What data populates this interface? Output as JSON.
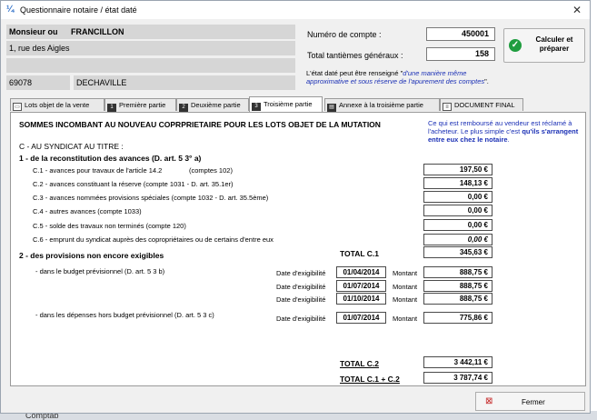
{
  "window": {
    "title": "Questionnaire notaire / état daté",
    "close_glyph": "✕"
  },
  "header": {
    "salutation": "Monsieur ou",
    "name": "FRANCILLON",
    "address1": "1, rue des Aigles",
    "address2": "",
    "postal_code": "69078",
    "city": "DECHAVILLE",
    "account_label": "Numéro de compte :",
    "account_value": "450001",
    "tantiemes_label": "Total tantièmes généraux :",
    "tantiemes_value": "158",
    "calc_button": "Calculer et préparer",
    "note_prefix": "L'état daté peut être renseigné \"",
    "note_italic": "d'une manière même approximative et sous réserve de l'apurement des comptes",
    "note_suffix": "\"."
  },
  "tabs": [
    {
      "label": "Lots objet de la vente",
      "active": false
    },
    {
      "label": "Première partie",
      "active": false
    },
    {
      "label": "Deuxième partie",
      "active": false
    },
    {
      "label": "Troisième partie",
      "active": true
    },
    {
      "label": "Annexe à la troisième partie",
      "active": false
    },
    {
      "label": "DOCUMENT FINAL",
      "active": false
    }
  ],
  "main": {
    "heading": "SOMMES INCOMBANT AU NOUVEAU COPRPRIETAIRE POUR LES LOTS OBJET DE LA MUTATION",
    "info_text1": "Ce qui est remboursé au vendeur est réclamé à l'acheteur. Le plus simple c'est ",
    "info_bold1": "qu'ils s'arrangent entre eux chez le notaire",
    "info_text2": ".",
    "section_c": "C - AU SYNDICAT AU TITRE :",
    "sub1": "1 - de la reconstitution des avances (D. art. 5 3° a)",
    "items": [
      {
        "label": "C.1 - avances pour travaux de l'article 14.2",
        "extra": "(comptes 102)",
        "amount": "197,50 €"
      },
      {
        "label": "C.2 - avances constituant la réserve (compte 1031 - D. art. 35.1er)",
        "extra": "",
        "amount": "148,13 €"
      },
      {
        "label": "C.3 - avances nommées provisions spéciales (compte 1032 - D. art. 35.5ème)",
        "extra": "",
        "amount": "0,00 €"
      },
      {
        "label": "C.4 - autres avances (compte 1033)",
        "extra": "",
        "amount": "0,00 €"
      },
      {
        "label": "C.5 - solde des travaux non terminés (compte 120)",
        "extra": "",
        "amount": "0,00 €"
      },
      {
        "label": "C.6 - emprunt du syndicat auprès des copropriétaires ou de certains d'entre eux",
        "extra": "",
        "amount": "0,00 €"
      }
    ],
    "total_c1_label": "TOTAL C.1",
    "total_c1_value": "345,63 €",
    "sub2": "2 - des provisions non encore exigibles",
    "budget_label": "- dans le budget prévisionnel (D. art. 5 3 b)",
    "date_label": "Date d'exigibilité",
    "montant_label": "Montant",
    "budget_rows": [
      {
        "date": "01/04/2014",
        "amount": "888,75 €"
      },
      {
        "date": "01/07/2014",
        "amount": "888,75 €"
      },
      {
        "date": "01/10/2014",
        "amount": "888,75 €"
      }
    ],
    "hors_label": "- dans les dépenses hors budget prévisionnel (D. art. 5 3 c)",
    "hors_row": {
      "date": "01/07/2014",
      "amount": "775,86 €"
    },
    "total_c2_label": "TOTAL C.2",
    "total_c2_value": "3 442,11 €",
    "total_c12_label": "TOTAL C.1 + C.2",
    "total_c12_value": "3 787,74 €"
  },
  "footer": {
    "close_button": "Fermer",
    "background_text": "Comptab"
  }
}
